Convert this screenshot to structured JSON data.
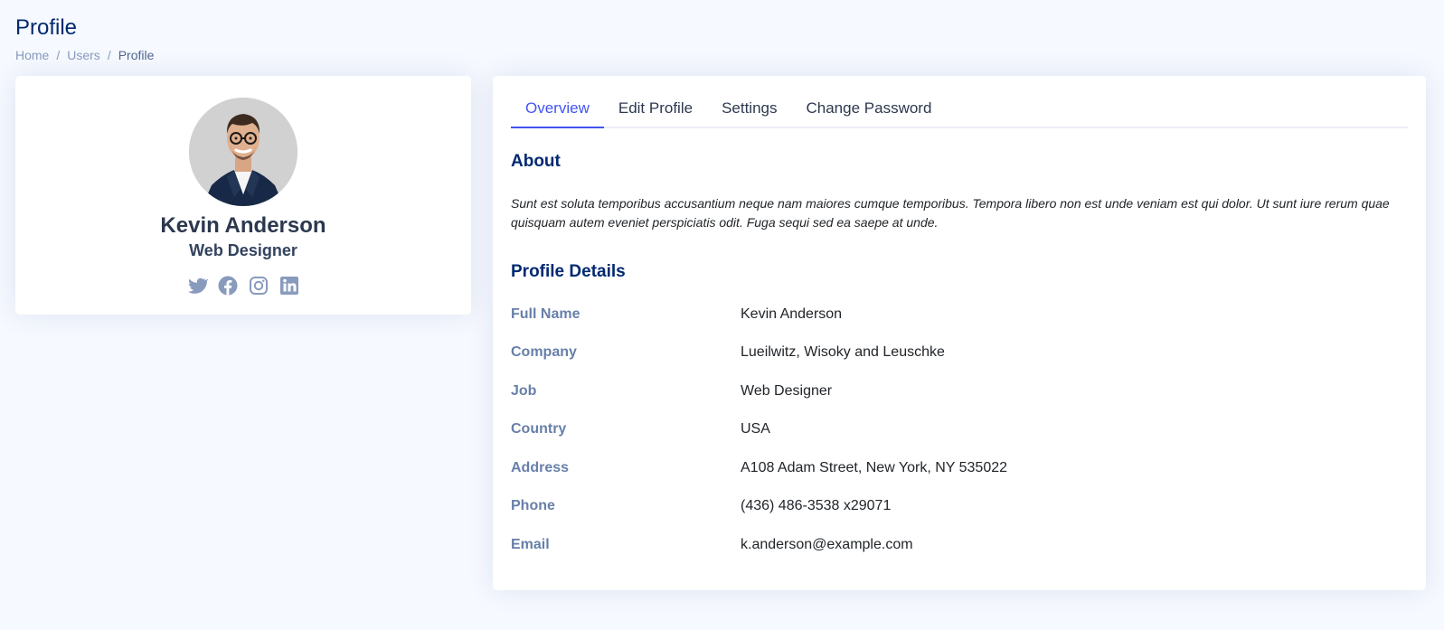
{
  "page": {
    "title": "Profile",
    "breadcrumb": [
      "Home",
      "Users",
      "Profile"
    ]
  },
  "profile": {
    "name": "Kevin Anderson",
    "job": "Web Designer",
    "social": [
      "twitter-icon",
      "facebook-icon",
      "instagram-icon",
      "linkedin-icon"
    ]
  },
  "tabs": [
    "Overview",
    "Edit Profile",
    "Settings",
    "Change Password"
  ],
  "active_tab": "Overview",
  "about": {
    "title": "About",
    "text": "Sunt est soluta temporibus accusantium neque nam maiores cumque temporibus. Tempora libero non est unde veniam est qui dolor. Ut sunt iure rerum quae quisquam autem eveniet perspiciatis odit. Fuga sequi sed ea saepe at unde."
  },
  "details": {
    "title": "Profile Details",
    "rows": [
      {
        "label": "Full Name",
        "value": "Kevin Anderson"
      },
      {
        "label": "Company",
        "value": "Lueilwitz, Wisoky and Leuschke"
      },
      {
        "label": "Job",
        "value": "Web Designer"
      },
      {
        "label": "Country",
        "value": "USA"
      },
      {
        "label": "Address",
        "value": "A108 Adam Street, New York, NY 535022"
      },
      {
        "label": "Phone",
        "value": "(436) 486-3538 x29071"
      },
      {
        "label": "Email",
        "value": "k.anderson@example.com"
      }
    ]
  },
  "colors": {
    "accent": "#4154f1",
    "heading": "#012970",
    "background": "#f6f9ff",
    "muted_label": "#899bbd"
  }
}
